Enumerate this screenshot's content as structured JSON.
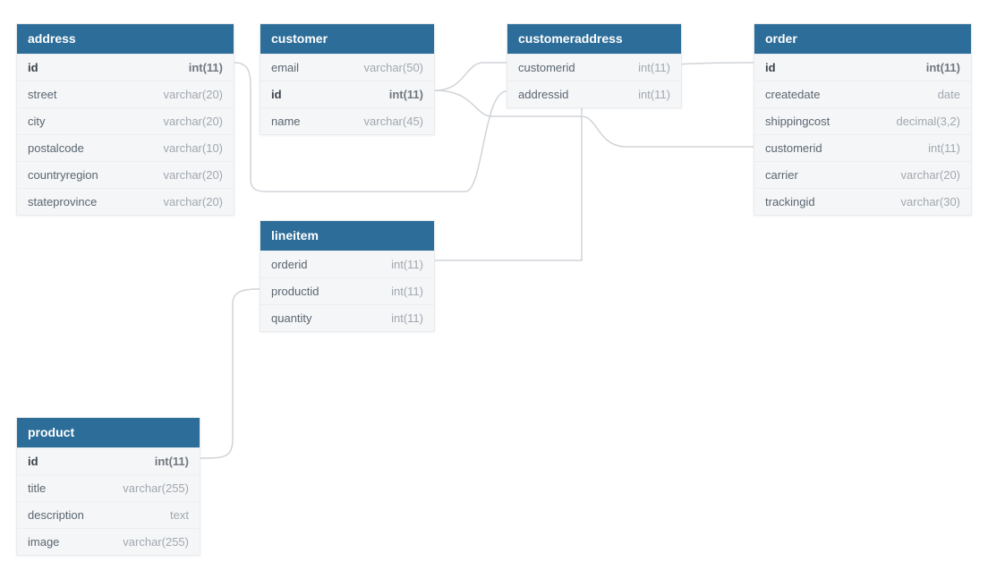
{
  "tables": {
    "address": {
      "title": "address",
      "columns": [
        {
          "name": "id",
          "type": "int(11)",
          "pk": true
        },
        {
          "name": "street",
          "type": "varchar(20)"
        },
        {
          "name": "city",
          "type": "varchar(20)"
        },
        {
          "name": "postalcode",
          "type": "varchar(10)"
        },
        {
          "name": "countryregion",
          "type": "varchar(20)"
        },
        {
          "name": "stateprovince",
          "type": "varchar(20)"
        }
      ]
    },
    "customer": {
      "title": "customer",
      "columns": [
        {
          "name": "email",
          "type": "varchar(50)"
        },
        {
          "name": "id",
          "type": "int(11)",
          "pk": true
        },
        {
          "name": "name",
          "type": "varchar(45)"
        }
      ]
    },
    "customeraddress": {
      "title": "customeraddress",
      "columns": [
        {
          "name": "customerid",
          "type": "int(11)"
        },
        {
          "name": "addressid",
          "type": "int(11)"
        }
      ]
    },
    "order": {
      "title": "order",
      "columns": [
        {
          "name": "id",
          "type": "int(11)",
          "pk": true
        },
        {
          "name": "createdate",
          "type": "date"
        },
        {
          "name": "shippingcost",
          "type": "decimal(3,2)"
        },
        {
          "name": "customerid",
          "type": "int(11)"
        },
        {
          "name": "carrier",
          "type": "varchar(20)"
        },
        {
          "name": "trackingid",
          "type": "varchar(30)"
        }
      ]
    },
    "lineitem": {
      "title": "lineitem",
      "columns": [
        {
          "name": "orderid",
          "type": "int(11)"
        },
        {
          "name": "productid",
          "type": "int(11)"
        },
        {
          "name": "quantity",
          "type": "int(11)"
        }
      ]
    },
    "product": {
      "title": "product",
      "columns": [
        {
          "name": "id",
          "type": "int(11)",
          "pk": true
        },
        {
          "name": "title",
          "type": "varchar(255)"
        },
        {
          "name": "description",
          "type": "text"
        },
        {
          "name": "image",
          "type": "varchar(255)"
        }
      ]
    }
  },
  "relations": [
    {
      "from": "customer.id",
      "to": "customeraddress.customerid"
    },
    {
      "from": "address.id",
      "to": "customeraddress.addressid"
    },
    {
      "from": "customer.id",
      "to": "order.customerid"
    },
    {
      "from": "order.id",
      "to": "lineitem.orderid"
    },
    {
      "from": "product.id",
      "to": "lineitem.productid"
    }
  ]
}
